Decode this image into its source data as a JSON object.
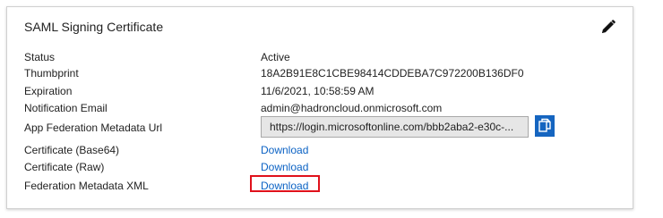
{
  "card": {
    "title": "SAML Signing Certificate",
    "edit_icon": "pencil-icon"
  },
  "fields": {
    "status": {
      "label": "Status",
      "value": "Active"
    },
    "thumbprint": {
      "label": "Thumbprint",
      "value": "18A2B91E8C1CBE98414CDDEBA7C972200B136DF0"
    },
    "expiration": {
      "label": "Expiration",
      "value": "11/6/2021, 10:58:59 AM"
    },
    "notification_email": {
      "label": "Notification Email",
      "value": "admin@hadroncloud.onmicrosoft.com"
    },
    "metadata_url": {
      "label": "App Federation Metadata Url",
      "value": "https://login.microsoftonline.com/bbb2aba2-e30c-...",
      "copy_icon": "copy-icon"
    },
    "cert_base64": {
      "label": "Certificate (Base64)",
      "link": "Download"
    },
    "cert_raw": {
      "label": "Certificate (Raw)",
      "link": "Download"
    },
    "federation_xml": {
      "label": "Federation Metadata XML",
      "link": "Download"
    }
  },
  "colors": {
    "link": "#0b62c4",
    "copy_button": "#1565c0",
    "highlight": "#e0111b"
  }
}
